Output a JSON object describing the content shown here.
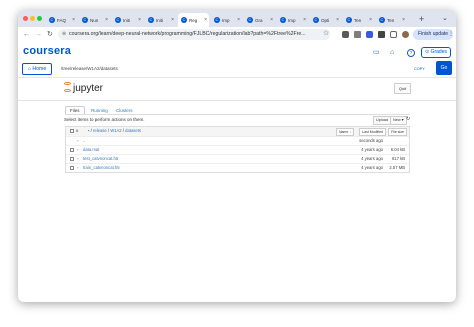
{
  "browser": {
    "tabs": [
      {
        "label": "FAQ"
      },
      {
        "label": "Nun"
      },
      {
        "label": "Initi"
      },
      {
        "label": "Initi"
      },
      {
        "label": "Reg",
        "active": true
      },
      {
        "label": "Imp"
      },
      {
        "label": "Gra"
      },
      {
        "label": "Imp"
      },
      {
        "label": "Opti"
      },
      {
        "label": "Ten"
      },
      {
        "label": "Ten"
      }
    ],
    "url": "coursera.org/learn/deep-neural-network/programming/FJLBC/regularization/lab?path=%2Ftree%2Fre...",
    "update_label": "Finish update"
  },
  "coursera": {
    "logo": "coursera",
    "grades_label": "Grades"
  },
  "toolbar": {
    "home_label": "Home",
    "path": "/tree/release/W1A2/datasets",
    "copy_label": "COPY",
    "go_label": "Go"
  },
  "jupyter": {
    "logo_text": "jupyter",
    "quit_label": "Quit",
    "tabs": [
      "Files",
      "Running",
      "Clusters"
    ],
    "select_text": "Select items to perform actions on them.",
    "upload_label": "Upload",
    "new_label": "New ▾",
    "header": {
      "count": "0",
      "crumbs": [
        "release",
        "W1A2",
        "datasets"
      ],
      "name_btn": "Name ↓",
      "modified_btn": "Last Modified",
      "size_btn": "File size"
    },
    "rows": [
      {
        "name": "..",
        "modified": "seconds ago",
        "size": ""
      },
      {
        "name": "data.mat",
        "modified": "4 years ago",
        "size": "6.04 kB"
      },
      {
        "name": "test_catvnoncat.h5",
        "modified": "4 years ago",
        "size": "617 kB"
      },
      {
        "name": "train_catvnoncat.h5",
        "modified": "4 years ago",
        "size": "2.57 MB"
      }
    ]
  }
}
